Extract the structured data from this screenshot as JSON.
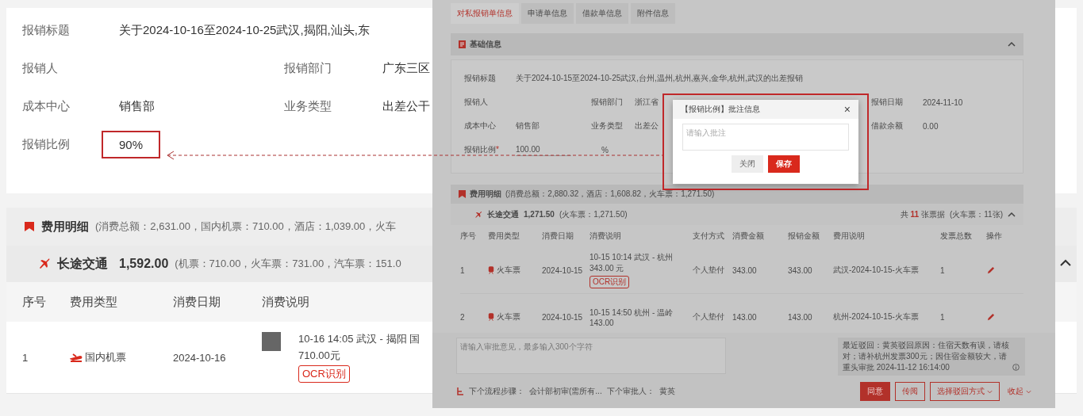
{
  "expense_report": {
    "details": {
      "rows": [
        [
          {
            "label": "报销标题",
            "value": "关于2024-10-16至2024-10-25武汉,揭阳,汕头,东"
          }
        ],
        [
          {
            "label": "报销人"
          },
          {
            "label": "报销部门",
            "value": "广东三区"
          }
        ],
        [
          {
            "label": "成本中心",
            "value": "销售部"
          },
          {
            "label": "业务类型",
            "value": "出差公干"
          }
        ],
        [
          {
            "label": "报销比例",
            "value": "90%",
            "highlighted": true
          }
        ]
      ]
    },
    "expenses": {
      "title": "费用明细",
      "summary": "(消费总额：2,631.00，国内机票：710.00，酒店：1,039.00，火车",
      "group": {
        "title": "长途交通",
        "amount": "1,592.00",
        "summary": "(机票：710.00，火车票：731.00，汽车票：151.0",
        "expanded": true
      },
      "columns": [
        "序号",
        "费用类型",
        "消费日期",
        "消费说明"
      ],
      "rows": [
        {
          "no": "1",
          "kind": "plane",
          "type": "国内机票",
          "date": "2024-10-16",
          "desc": [
            "10-16 14:05 武汉 - 揭阳 国",
            "710.00元"
          ],
          "badge": "OCR识别"
        }
      ]
    }
  },
  "review_panel": {
    "tabs": [
      {
        "label": "对私报销单信息",
        "selected": true
      },
      {
        "label": "申请单信息",
        "selected": false
      },
      {
        "label": "借款单信息",
        "selected": false
      },
      {
        "label": "附件信息",
        "selected": false
      }
    ],
    "basic_info": {
      "title": "基础信息",
      "expanded": true,
      "rows": [
        [
          {
            "label": "报销标题",
            "value": "关于2024-10-15至2024-10-25武汉,台州,温州,杭州,嘉兴,金华,杭州,武汉的出差报销",
            "kind": "text"
          }
        ],
        [
          {
            "label": "报销人"
          },
          {
            "label": "报销部门",
            "value": "浙江省",
            "kind": "text"
          },
          {
            "label": "报销日期",
            "value": "2024-11-10",
            "kind": "text"
          }
        ],
        [
          {
            "label": "成本中心",
            "value": "销售部",
            "kind": "text"
          },
          {
            "label": "业务类型",
            "value": "出差公",
            "kind": "text"
          },
          {
            "label": "借款余额",
            "value": "0.00",
            "kind": "text"
          }
        ],
        [
          {
            "label": "报销比例",
            "mark": "*",
            "value": "100.00",
            "unit": "%",
            "kind": "input"
          }
        ]
      ]
    },
    "dialog": {
      "title": "【报销比例】批注信息",
      "close": "×",
      "placeholder": "请输入批注",
      "buttons": [
        {
          "label": "关闭",
          "kind": "secondary"
        },
        {
          "label": "保存",
          "kind": "primary"
        }
      ]
    },
    "expenses": {
      "title": "费用明细",
      "summary": "(消费总额：2,880.32，酒店：1,608.82，火车票：1,271.50)",
      "group": {
        "title": "长途交通",
        "amount": "1,271.50",
        "summary": "(火车票：1,271.50)",
        "count": "共 **11** 张票据",
        "count_note": "(火车票：11张)",
        "expanded": true
      },
      "columns": [
        "序号",
        "费用类型",
        "消费日期",
        "消费说明",
        "支付方式",
        "消费金额",
        "报销金额",
        "费用说明",
        "发票总数",
        "操作"
      ],
      "rows": [
        {
          "no": "1",
          "kind": "train",
          "type": "火车票",
          "date": "2024-10-15",
          "desc": "10-15 10:14 武汉 - 杭州 343.00 元",
          "badge": "OCR识别",
          "payment": "个人垫付",
          "spent": "343.00",
          "claimed": "343.00",
          "note": "武汉-2024-10-15-火车票",
          "invoices": "1"
        },
        {
          "no": "2",
          "kind": "train",
          "type": "火车票",
          "date": "2024-10-15",
          "desc": "10-15 14:50 杭州 - 温岭 143.00",
          "payment": "个人垫付",
          "spent": "143.00",
          "claimed": "143.00",
          "note": "杭州-2024-10-15-火车票",
          "invoices": "1"
        }
      ]
    },
    "approval": {
      "placeholder": "请输入审批意见，最多输入300个字符",
      "last_rejection": "最近驳回：黄英驳回原因：住宿天数有误，请核对；请补杭州发票300元；因住宿金额较大，请重头审批 2024-11-12 16:14:00",
      "next_step_label": "下个流程步骤：",
      "next_step": "会计部初审(需所有...",
      "next_approver_label": "下个审批人：",
      "next_approver": "黄英",
      "buttons": [
        {
          "label": "同意",
          "kind": "primary"
        },
        {
          "label": "传阅",
          "kind": "outline"
        },
        {
          "label": "选择驳回方式",
          "kind": "dropdown"
        },
        {
          "label": "收起",
          "kind": "link"
        }
      ]
    }
  }
}
